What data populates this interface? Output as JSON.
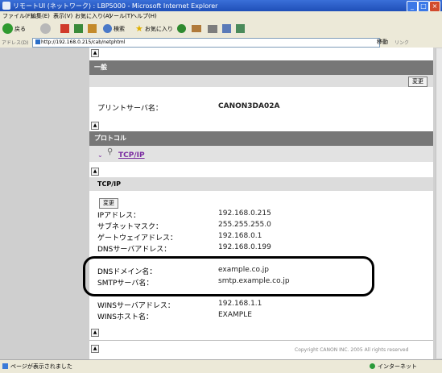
{
  "window": {
    "title": "リモートUI (ネットワーク) : LBP5000 - Microsoft Internet Explorer",
    "controls": [
      "_",
      "□",
      "×"
    ]
  },
  "menu": [
    "ファイル(F)",
    "編集(E)",
    "表示(V)",
    "お気に入り(A)",
    "ツール(T)",
    "ヘルプ(H)"
  ],
  "toolbar": {
    "back": "戻る",
    "search": "検索",
    "favorites": "お気に入り"
  },
  "address": {
    "label": "アドレス(D)",
    "url": "http://192.168.0.215/cab/netphtml",
    "go": "移動",
    "links": "リンク"
  },
  "content": {
    "general_header": "一般",
    "change_label": "変更",
    "print_server_label": "プリントサーバ名：",
    "print_server_value": "CANON3DA02A",
    "protocol_header": "プロトコル",
    "tcpip_link": "TCP/IP",
    "tcpip_section": "TCP/IP",
    "change_label_2": "変更",
    "rows": [
      {
        "label": "IPアドレス：",
        "value": "192.168.0.215"
      },
      {
        "label": "サブネットマスク：",
        "value": "255.255.255.0"
      },
      {
        "label": "ゲートウェイアドレス：",
        "value": "192.168.0.1"
      },
      {
        "label": "DNSサーバアドレス：",
        "value": "192.168.0.199"
      },
      {
        "label": "DNSドメイン名：",
        "value": "example.co.jp"
      },
      {
        "label": "SMTPサーバ名：",
        "value": "smtp.example.co.jp"
      },
      {
        "label": "WINSサーバアドレス：",
        "value": "192.168.1.1"
      },
      {
        "label": "WINSホスト名：",
        "value": "EXAMPLE"
      }
    ],
    "copyright": "Copyright CANON INC. 2005 All rights reserved"
  },
  "status": {
    "left": "ページが表示されました",
    "zone": "インターネット"
  }
}
